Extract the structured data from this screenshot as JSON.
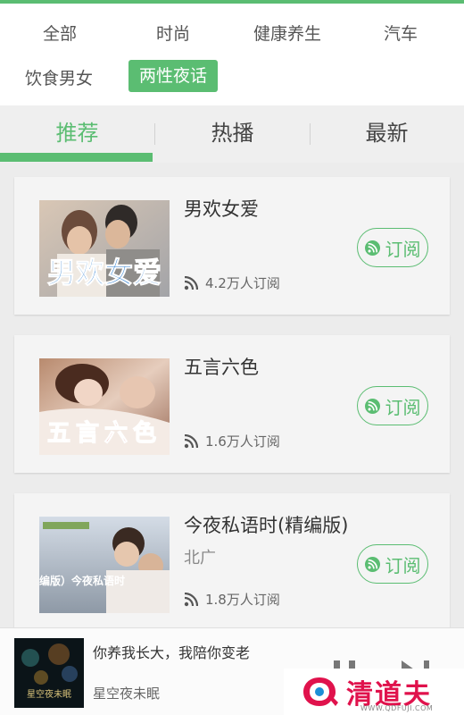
{
  "categories": [
    {
      "label": "全部",
      "active": false
    },
    {
      "label": "时尚",
      "active": false
    },
    {
      "label": "健康养生",
      "active": false
    },
    {
      "label": "汽车",
      "active": false
    },
    {
      "label": "饮食男女",
      "active": false
    },
    {
      "label": "两性夜话",
      "active": true
    }
  ],
  "tabs": [
    {
      "label": "推荐",
      "active": true
    },
    {
      "label": "热播",
      "active": false
    },
    {
      "label": "最新",
      "active": false
    }
  ],
  "programs": [
    {
      "title": "男欢女爱",
      "subtitle": "",
      "subscribers": "4.2万人订阅",
      "button": "订阅",
      "cover_text": "男欢女爱"
    },
    {
      "title": "五言六色",
      "subtitle": "",
      "subscribers": "1.6万人订阅",
      "button": "订阅",
      "cover_text": "五言六色"
    },
    {
      "title": "今夜私语时(精编版)",
      "subtitle": "北广",
      "subscribers": "1.8万人订阅",
      "button": "订阅",
      "cover_text": "（精编版）今夜私语时"
    }
  ],
  "player": {
    "title": "你养我长大，我陪你变老",
    "album": "星空夜未眠",
    "cover_text": "星空夜未眠"
  },
  "watermark": {
    "brand": "清道夫",
    "url": "WWW.QDFUJI.COM"
  },
  "colors": {
    "accent": "#5bbd72",
    "watermark": "#e0124c"
  },
  "icons": {
    "rss": "rss-icon",
    "subscribe": "subscribe-icon",
    "pause": "pause-icon",
    "next": "next-icon"
  }
}
